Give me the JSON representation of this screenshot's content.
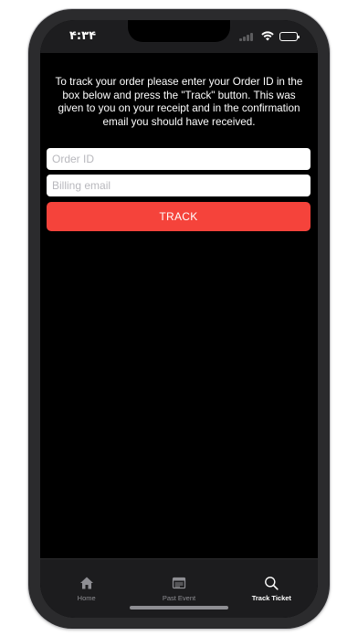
{
  "status_bar": {
    "time": "۴:۳۴"
  },
  "track_order": {
    "instructions": "To track your order please enter your Order ID in the box below and press the \"Track\" button. This was given to you on your receipt and in the confirmation email you should have received.",
    "order_id_placeholder": "Order ID",
    "email_placeholder": "Billing email",
    "track_label": "TRACK"
  },
  "tab_bar": {
    "tabs": [
      {
        "label": "Home",
        "icon": "home-icon",
        "active": false
      },
      {
        "label": "Past Event",
        "icon": "past-event-icon",
        "active": false
      },
      {
        "label": "Track Ticket",
        "icon": "search-icon",
        "active": true
      }
    ]
  },
  "colors": {
    "accent": "#f5433b",
    "background": "#000000",
    "tab_bar": "#1c1c1e",
    "inactive_tab": "#8e8e93"
  }
}
